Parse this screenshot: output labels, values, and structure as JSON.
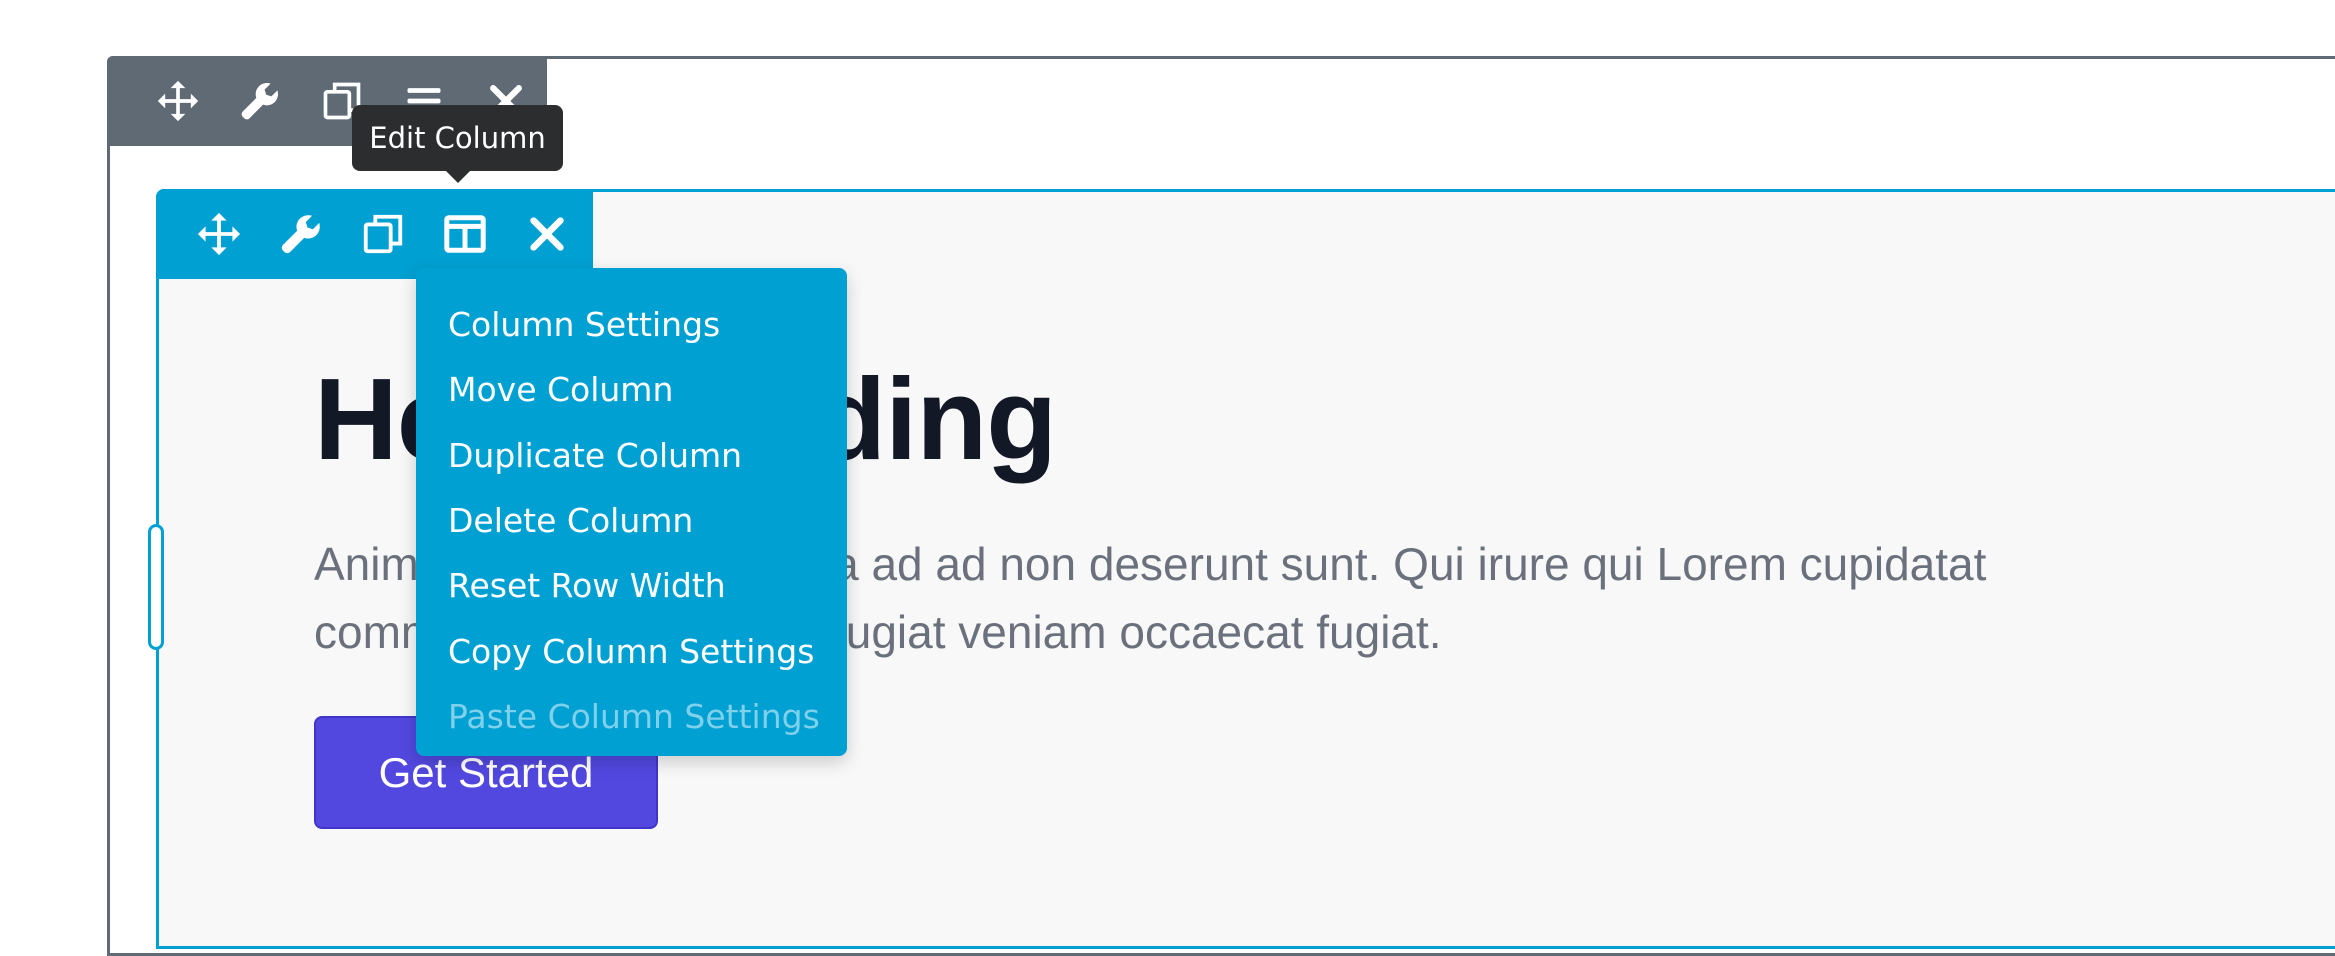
{
  "row_toolbar": {
    "icons": [
      "move-icon",
      "wrench-icon",
      "copy-icon",
      "menu-icon",
      "close-icon"
    ]
  },
  "column_toolbar": {
    "icons": [
      "move-icon",
      "wrench-icon",
      "copy-icon",
      "columns-icon",
      "close-icon"
    ]
  },
  "tooltip": {
    "text": "Edit Column"
  },
  "column_menu": {
    "items": [
      {
        "label": "Column Settings",
        "enabled": true
      },
      {
        "label": "Move Column",
        "enabled": true
      },
      {
        "label": "Duplicate Column",
        "enabled": true
      },
      {
        "label": "Delete Column",
        "enabled": true
      },
      {
        "label": "Reset Row Width",
        "enabled": true
      },
      {
        "label": "Copy Column Settings",
        "enabled": true
      },
      {
        "label": "Paste Column Settings",
        "enabled": false
      }
    ]
  },
  "content": {
    "heading": "Hero Heading",
    "paragraph": "Anim aute id magna aliqua ad ad non deserunt sunt. Qui irure qui Lorem cupidatat commodo. Elit sunt amet fugiat veniam occaecat fugiat.",
    "cta_label": "Get Started"
  },
  "colors": {
    "row_toolbar": "#5f6a75",
    "column_accent": "#00a0d2",
    "button": "#5248e0",
    "heading": "#121826",
    "paragraph": "#6a717d"
  }
}
